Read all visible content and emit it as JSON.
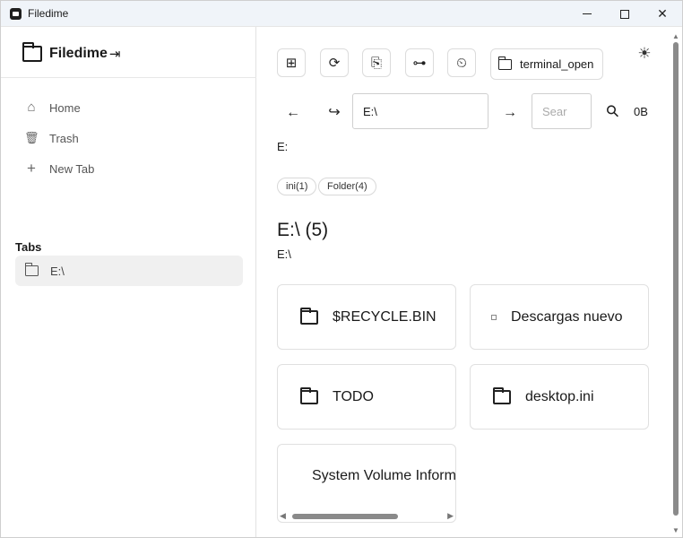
{
  "window": {
    "title": "Filedime",
    "minimize_label": "",
    "maximize_label": "",
    "close_label": "✕"
  },
  "sidebar": {
    "brand": "Filedime",
    "toggle_icon": "⇥",
    "nav": [
      {
        "label": "Home",
        "icon": "home-icon",
        "glyph": "⌂"
      },
      {
        "label": "Trash",
        "icon": "trash-icon",
        "glyph": "🗑"
      },
      {
        "label": "New Tab",
        "icon": "plus-icon",
        "glyph": "+"
      }
    ],
    "tabs_heading": "Tabs",
    "tabs": [
      {
        "label": "E:\\"
      }
    ]
  },
  "toolbar": {
    "grid_glyph": "⊞",
    "refresh_glyph": "⟳",
    "clip_glyph": "⎘",
    "tree_glyph": "⊶",
    "history_glyph": "⏲",
    "terminal_label": "terminal_open",
    "theme_glyph": "☀"
  },
  "navbar": {
    "back_glyph": "←",
    "forward_glyph": "↪",
    "go_glyph": "→",
    "path_value": "E:\\",
    "search_placeholder": "Sear",
    "search_glyph": "⚲",
    "size_label": "0B"
  },
  "content": {
    "drive_label": "E:",
    "chips": [
      "ini(1)",
      "Folder(4)"
    ],
    "dir_title": "E:\\ (5)",
    "dir_sub": "E:\\",
    "items": [
      {
        "name": "$RECYCLE.BIN",
        "kind": "folder"
      },
      {
        "name": "Descargas nuevo",
        "kind": "image"
      },
      {
        "name": "TODO",
        "kind": "folder"
      },
      {
        "name": "desktop.ini",
        "kind": "folder"
      },
      {
        "name": "System Volume Information",
        "kind": "none"
      }
    ]
  },
  "scroll": {
    "left_arrow": "◀",
    "right_arrow": "▶",
    "up_arrow": "▲",
    "down_arrow": "▼"
  }
}
